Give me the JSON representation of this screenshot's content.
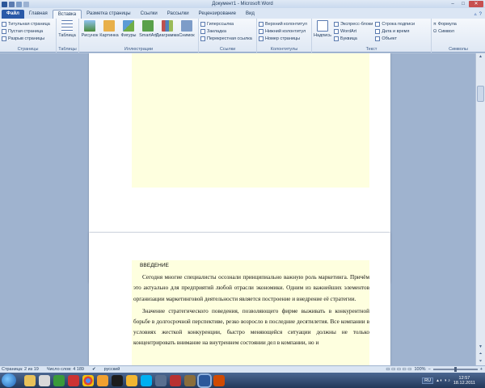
{
  "window": {
    "title": "Документ1 - Microsoft Word"
  },
  "tabs": {
    "file": "Файл",
    "items": [
      "Главная",
      "Вставка",
      "Разметка страницы",
      "Ссылки",
      "Рассылки",
      "Рецензирование",
      "Вид"
    ],
    "active_index": 1
  },
  "ribbon": {
    "pages": {
      "title": "Страницы",
      "items": [
        "Титульная страница",
        "Пустая страница",
        "Разрыв страницы"
      ]
    },
    "tables": {
      "title": "Таблицы",
      "table": "Таблица"
    },
    "illustrations": {
      "title": "Иллюстрации",
      "items": [
        "Рисунок",
        "Картинка",
        "Фигуры",
        "SmartArt",
        "Диаграмма",
        "Снимок"
      ]
    },
    "links": {
      "title": "Ссылки",
      "items": [
        "Гиперссылка",
        "Закладка",
        "Перекрестная ссылка"
      ]
    },
    "headers": {
      "title": "Колонтитулы",
      "items": [
        "Верхний колонтитул",
        "Нижний колонтитул",
        "Номер страницы"
      ]
    },
    "text": {
      "title": "Текст",
      "textbox": "Надпись",
      "items": [
        "Экспресс-блоки",
        "WordArt",
        "Буквица"
      ],
      "items2": [
        "Строка подписи",
        "Дата и время",
        "Объект"
      ]
    },
    "symbols": {
      "title": "Символы",
      "items": [
        "Формула",
        "Символ"
      ]
    }
  },
  "document": {
    "heading": "ВВЕДЕНИЕ",
    "paragraphs": [
      "Сегодня многие специалисты осознали принципиально важную роль маркетинга. Причём это актуально для предприятий любой отрасли экономики. Одним из важнейших элементов организации маркетинговой деятельности является построение и внедрение её стратегии.",
      "Значение стратегического поведения, позволяющего фирме выживать в конкурентной борьбе в долгосрочной перспективе, резко возросло в последние десятилетия. Все компании в условиях жесткой конкуренции, быстро меняющейся ситуации должны не только концентрировать внимание на внутреннем состоянии дел в компании, но и"
    ]
  },
  "status": {
    "page": "Страница: 2 из 19",
    "words": "Число слов: 4 189",
    "language": "русский",
    "zoom": "100%"
  },
  "taskbar": {
    "lang": "RU",
    "time": "12:57",
    "date": "18.12.2011"
  },
  "colors": {
    "file_tab": "#2a5aa8",
    "highlight": "#feffdf"
  }
}
